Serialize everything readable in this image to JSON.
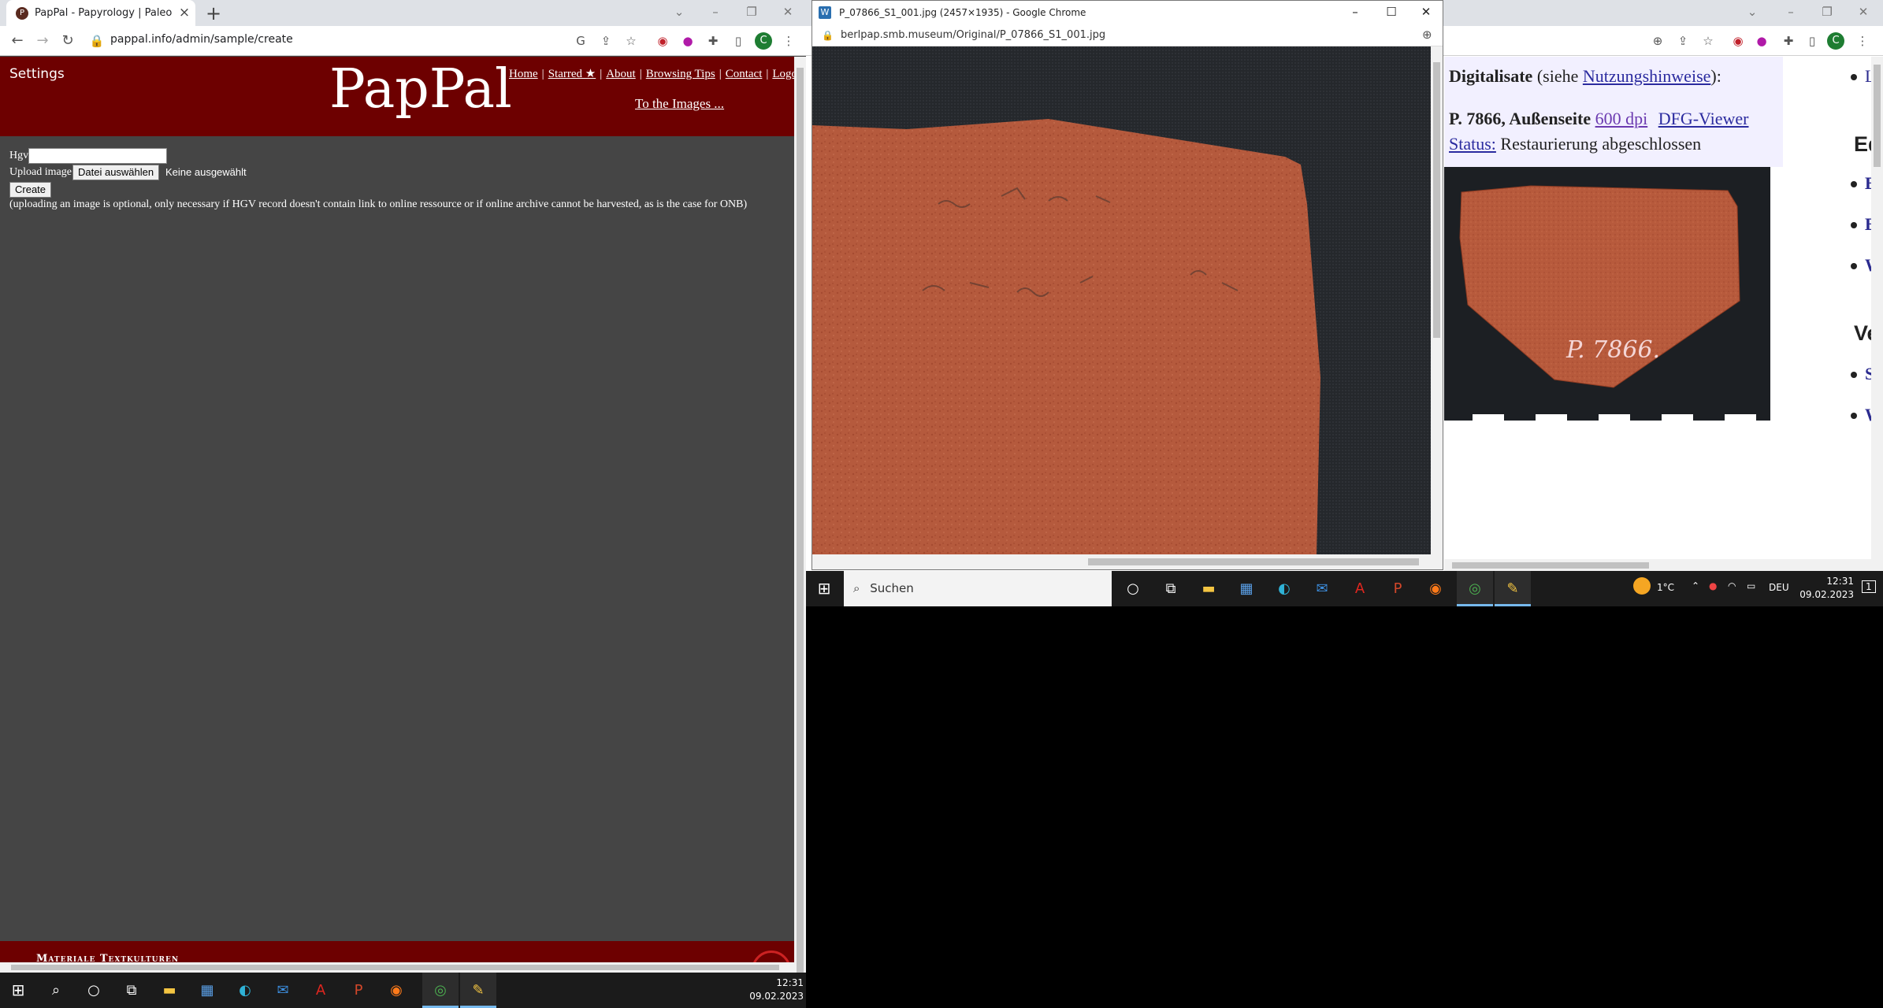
{
  "left_window": {
    "tab_title": "PapPal - Papyrology | Paleograph",
    "url": "pappal.info/admin/sample/create",
    "settings_label": "Settings",
    "logo": "PapPal",
    "nav": {
      "home": "Home",
      "starred": "Starred ★",
      "about": "About",
      "browsing_tips": "Browsing Tips",
      "contact": "Contact",
      "logout": "Logou"
    },
    "to_images": "To the Images ...",
    "form": {
      "hgv_label": "Hgv",
      "hgv_value": "",
      "upload_label": "Upload image",
      "file_button": "Datei auswählen",
      "file_status": "Keine ausgewählt",
      "create_button": "Create",
      "note": "(uploading an image is optional, only necessary if HGV record doesn't contain link to online ressource or if online archive cannot be harvested, as is the case for ONB)"
    },
    "footer_text": "Materiale Textkulturen"
  },
  "popup_window": {
    "title": "P_07866_S1_001.jpg (2457×1935) - Google Chrome",
    "url": "berlpap.smb.museum/Original/P_07866_S1_001.jpg"
  },
  "right_window": {
    "digitalisate": {
      "label": "Digitalisate",
      "paren_open": "(siehe",
      "link": "Nutzungshinweise",
      "paren_close": "):"
    },
    "record_label": "P. 7866, Außenseite",
    "dpi_link": "600 dpi",
    "dfg_link": "DFG-Viewer",
    "status_label": "Status:",
    "status_value": "Restaurierung abgeschlossen",
    "photo_inscription": "P. 7866.",
    "sidebar": {
      "item_lit": "Lit",
      "heading_edi": "Editi",
      "item_bo": "BO",
      "item_bk": "BK",
      "item_we1": "We",
      "heading_vers": "Vers",
      "item_sb": "SB",
      "item_we2": "We"
    }
  },
  "taskbar_left": {
    "time": "12:31",
    "date": "09.02.2023"
  },
  "taskbar_right": {
    "search_placeholder": "Suchen",
    "weather": "1°C",
    "lang": "DEU",
    "time": "12:31",
    "date": "09.02.2023",
    "notif_count": "1"
  }
}
